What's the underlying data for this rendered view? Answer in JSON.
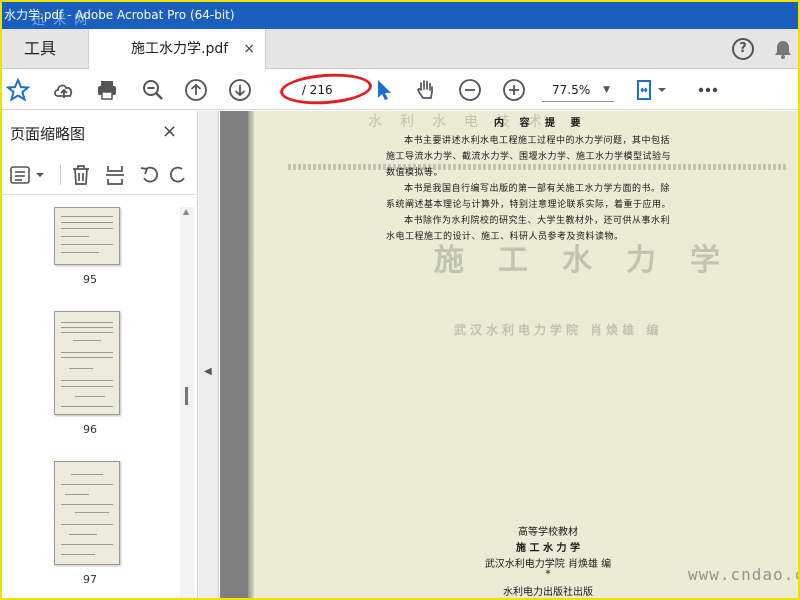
{
  "window": {
    "title": "水力学.pdf - Adobe Acrobat Pro (64-bit)",
    "watermark_tl": "迅 米 网"
  },
  "tabs": {
    "tools_label": "工具",
    "doc_label": "施工水力学.pdf",
    "doc_close": "×",
    "help_label": "?"
  },
  "toolbar": {
    "page_current": "",
    "page_total": "/ 216",
    "zoom": "77.5%",
    "zoom_caret": "▼"
  },
  "sidebar": {
    "title": "页面缩略图",
    "close": "×",
    "thumbnails": [
      {
        "page": "95"
      },
      {
        "page": "96"
      },
      {
        "page": "97"
      }
    ]
  },
  "document": {
    "heading": "内 容 提 要",
    "paragraphs": [
      "本书主要讲述水利水电工程施工过程中的水力学问题，其中包括",
      "施工导流水力学、截流水力学、围堰水力学、施工水力学模型试验与",
      "数值模拟等。",
      "本书是我国自行编写出版的第一部有关施工水力学方面的书。除",
      "系统阐述基本理论与计算外，特别注意理论联系实际，着重于应用。",
      "本书除作为水利院校的研究生、大学生教材外，还可供从事水利",
      "水电工程施工的设计、施工、科研人员参考及资料读物。"
    ],
    "ghost_title": "施工水力学",
    "ghost_subtitle": "武汉水利电力学院 肖焕雄 编",
    "ghost_top": "水利水电技术",
    "footer": [
      "高等学校教材",
      "施 工 水 力 学",
      "武汉水利电力学院  肖焕雄  编",
      "*",
      "水利电力出版社出版"
    ],
    "watermark_br": "www.cndao.com"
  },
  "colors": {
    "titlebar": "#1a5fbf",
    "accent": "#1a6fd0",
    "annotation": "#e02020",
    "page": "#ebebd6",
    "frame": "#f0e200"
  },
  "icons": [
    "star-icon",
    "cloud-upload-icon",
    "print-icon",
    "zoom-out-icon",
    "page-up-icon",
    "page-down-icon",
    "pointer-icon",
    "hand-icon",
    "zoom-minus-icon",
    "zoom-plus-icon",
    "fit-page-icon",
    "more-icon",
    "help-icon",
    "bell-icon",
    "options-icon",
    "trash-icon",
    "extract-icon",
    "undo-icon",
    "redo-icon"
  ]
}
